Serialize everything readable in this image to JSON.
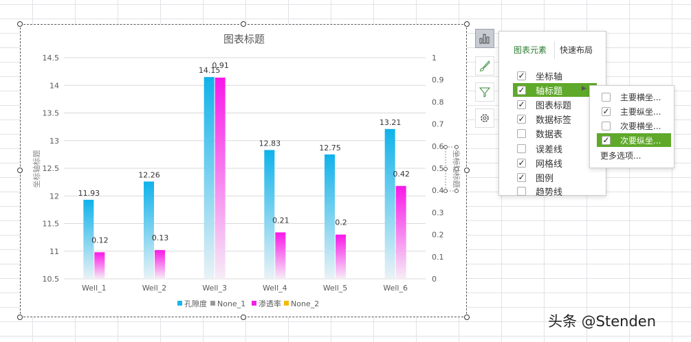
{
  "chart_data": {
    "type": "bar",
    "title": "图表标题",
    "ylabel": "坐标轴标题",
    "y2label": "坐标轴标题",
    "categories": [
      "Well_1",
      "Well_2",
      "Well_3",
      "Well_4",
      "Well_5",
      "Well_6"
    ],
    "ylim": [
      10.5,
      14.5
    ],
    "yticks": [
      "10.5",
      "11",
      "11.5",
      "12",
      "12.5",
      "13",
      "13.5",
      "14",
      "14.5"
    ],
    "y2lim": [
      0,
      1
    ],
    "y2ticks": [
      "0",
      "0.1",
      "0.2",
      "0.3",
      "0.4",
      "0.5",
      "0.6",
      "0.7",
      "0.8",
      "0.9",
      "1"
    ],
    "series": [
      {
        "name": "孔隙度",
        "axis": "primary",
        "values": [
          11.93,
          12.26,
          14.15,
          12.83,
          12.75,
          13.21
        ],
        "labels": [
          "11.93",
          "12.26",
          "14.15",
          "12.83",
          "12.75",
          "13.21"
        ],
        "color": "#1ab4ea"
      },
      {
        "name": "None_1",
        "axis": "primary",
        "values": [],
        "color": "#999999"
      },
      {
        "name": "渗透率",
        "axis": "secondary",
        "values": [
          0.12,
          0.13,
          0.91,
          0.21,
          0.2,
          0.42
        ],
        "labels": [
          "0.12",
          "0.13",
          "0.91",
          "0.21",
          "0.2",
          "0.42"
        ],
        "color": "#f21ee6"
      },
      {
        "name": "None_2",
        "axis": "secondary",
        "values": [],
        "color": "#f5b800"
      }
    ],
    "grid": true,
    "legend": "bottom"
  },
  "panel": {
    "tabs": [
      "图表元素",
      "快速布局"
    ],
    "items": [
      {
        "label": "坐标轴",
        "checked": true
      },
      {
        "label": "轴标题",
        "checked": true
      },
      {
        "label": "图表标题",
        "checked": true
      },
      {
        "label": "数据标签",
        "checked": true
      },
      {
        "label": "数据表",
        "checked": false
      },
      {
        "label": "误差线",
        "checked": false
      },
      {
        "label": "网格线",
        "checked": true
      },
      {
        "label": "图例",
        "checked": true
      },
      {
        "label": "趋势线",
        "checked": false
      }
    ]
  },
  "submenu": {
    "items": [
      {
        "label": "主要横坐...",
        "checked": false
      },
      {
        "label": "主要纵坐...",
        "checked": true
      },
      {
        "label": "次要横坐...",
        "checked": false
      },
      {
        "label": "次要纵坐...",
        "checked": true
      }
    ],
    "more": "更多选项..."
  },
  "sidebar_icons": [
    "chart-elements-icon",
    "brush-icon",
    "filter-icon",
    "gear-icon"
  ],
  "watermark": "头条 @Stenden"
}
